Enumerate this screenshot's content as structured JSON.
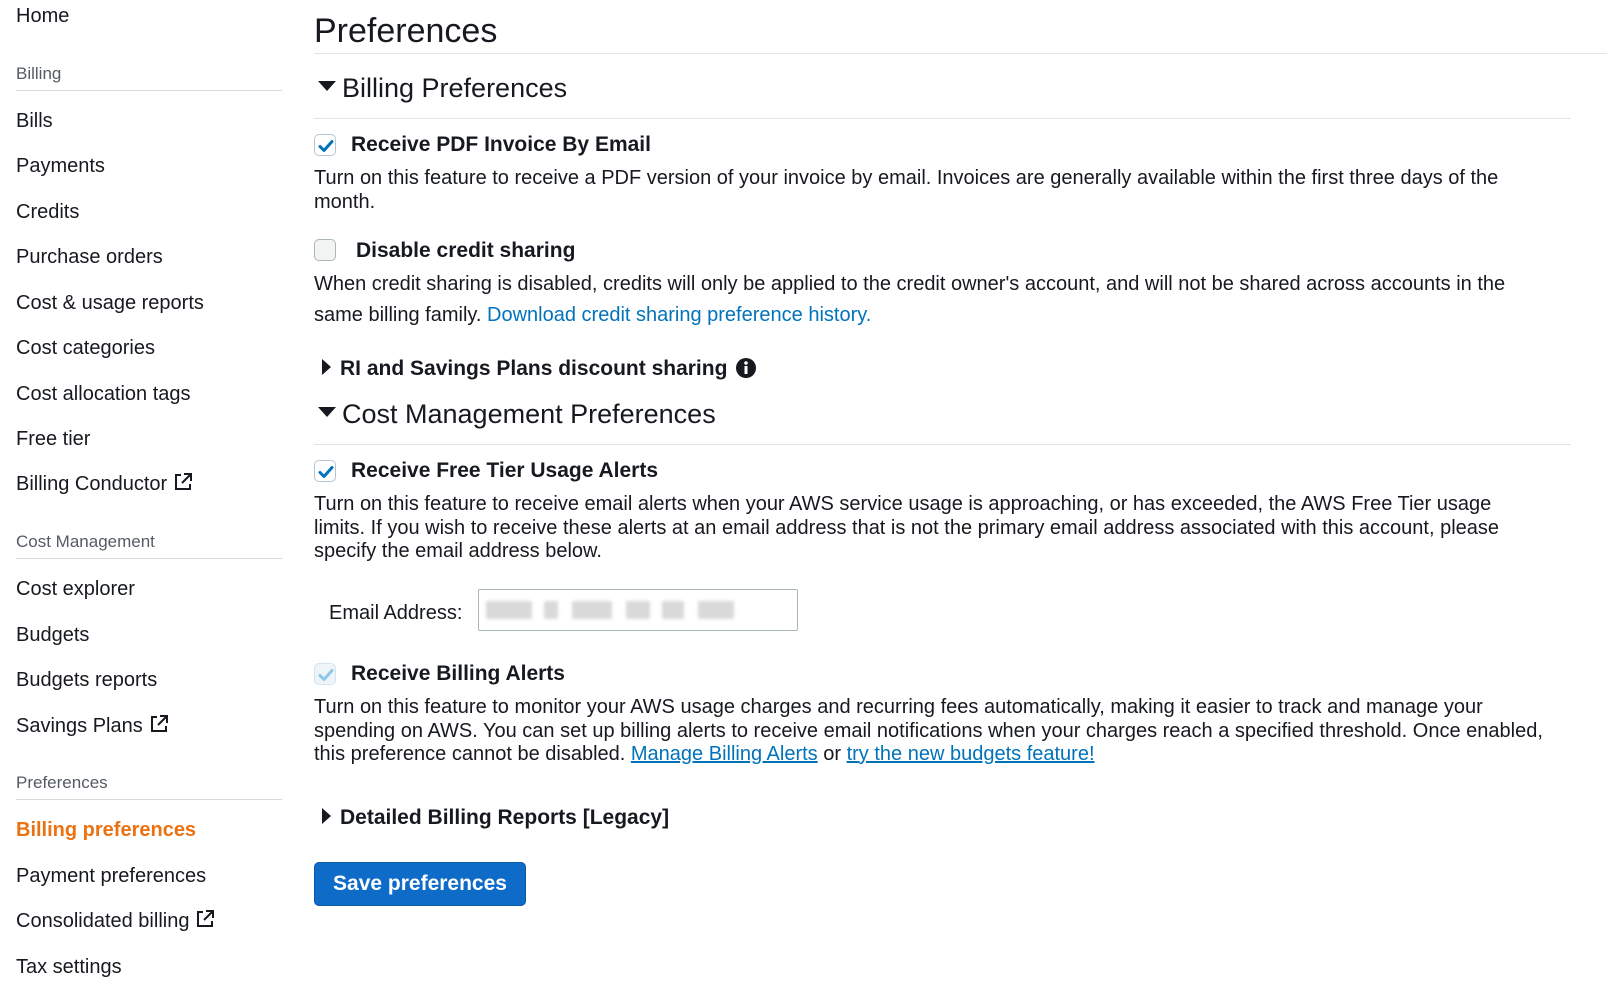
{
  "sidebar": {
    "home": "Home",
    "billing_header": "Billing",
    "billing_items": [
      {
        "label": "Bills"
      },
      {
        "label": "Payments"
      },
      {
        "label": "Credits"
      },
      {
        "label": "Purchase orders"
      },
      {
        "label": "Cost & usage reports"
      },
      {
        "label": "Cost categories"
      },
      {
        "label": "Cost allocation tags"
      },
      {
        "label": "Free tier"
      },
      {
        "label": "Billing Conductor",
        "external": true
      }
    ],
    "cost_header": "Cost Management",
    "cost_items": [
      {
        "label": "Cost explorer"
      },
      {
        "label": "Budgets"
      },
      {
        "label": "Budgets reports"
      },
      {
        "label": "Savings Plans",
        "external": true
      }
    ],
    "pref_header": "Preferences",
    "pref_items": [
      {
        "label": "Billing preferences",
        "active": true
      },
      {
        "label": "Payment preferences"
      },
      {
        "label": "Consolidated billing",
        "external": true
      },
      {
        "label": "Tax settings"
      }
    ]
  },
  "main": {
    "title": "Preferences",
    "billing_section": {
      "heading": "Billing Preferences",
      "pdf_invoice": {
        "label": "Receive PDF Invoice By Email",
        "checked": true,
        "description": "Turn on this feature to receive a PDF version of your invoice by email. Invoices are generally available within the first three days of the month."
      },
      "credit_sharing": {
        "label": "Disable credit sharing",
        "checked": false,
        "description": "When credit sharing is disabled, credits will only be applied to the credit owner's account, and will not be shared across accounts in the same billing family.",
        "link": "Download credit sharing preference history."
      },
      "ri_sharing": {
        "label": "RI and Savings Plans discount sharing"
      }
    },
    "cost_section": {
      "heading": "Cost Management Preferences",
      "free_tier": {
        "label": "Receive Free Tier Usage Alerts",
        "checked": true,
        "description": "Turn on this feature to receive email alerts when your AWS service usage is approaching, or has exceeded, the AWS Free Tier usage limits. If you wish to receive these alerts at an email address that is not the primary email address associated with this account, please specify the email address below.",
        "email_label": "Email Address:",
        "email_value": ""
      },
      "billing_alerts": {
        "label": "Receive Billing Alerts",
        "checked": true,
        "disabled": true,
        "description": "Turn on this feature to monitor your AWS usage charges and recurring fees automatically, making it easier to track and manage your spending on AWS. You can set up billing alerts to receive email notifications when your charges reach a specified threshold. Once enabled, this preference cannot be disabled.",
        "link_manage": "Manage Billing Alerts",
        "or": "or",
        "link_budgets": "try the new budgets feature!"
      },
      "detailed_reports": {
        "label": "Detailed Billing Reports [Legacy]"
      }
    },
    "save_label": "Save preferences"
  },
  "colors": {
    "accent_active": "#ec7211",
    "link": "#0073bb",
    "primary_button": "#0e6cc8",
    "checkbox_check": "#0073bb"
  },
  "icons": {
    "external": "external-link-icon",
    "info": "info-icon",
    "check": "check-icon"
  }
}
